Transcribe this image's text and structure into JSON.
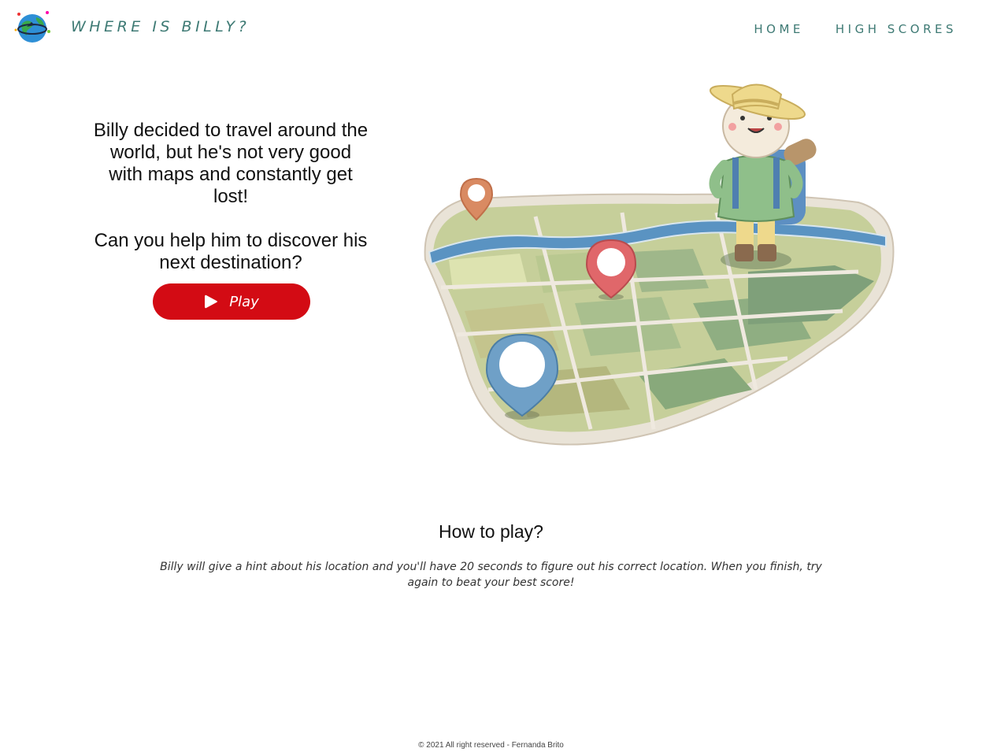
{
  "header": {
    "brand": "WHERE IS BILLY?",
    "nav": [
      {
        "label": "HOME"
      },
      {
        "label": "HIGH SCORES"
      }
    ]
  },
  "intro": {
    "paragraph1": "Billy decided to travel around the world, but he's not very good with maps and constantly get lost!",
    "paragraph2": "Can you help him to discover his next destination?",
    "play_label": "Play"
  },
  "howto": {
    "title": "How to play?",
    "text": "Billy will give a hint about his location and you'll have 20 seconds to figure out his correct location. When you finish, try again to beat your best score!"
  },
  "footer": {
    "text": "© 2021 All right reserved - Fernanda Brito"
  },
  "colors": {
    "accent": "#3e7a74",
    "button": "#d30b14"
  },
  "icons": {
    "logo": "globe-logo-icon",
    "play": "play-icon"
  }
}
